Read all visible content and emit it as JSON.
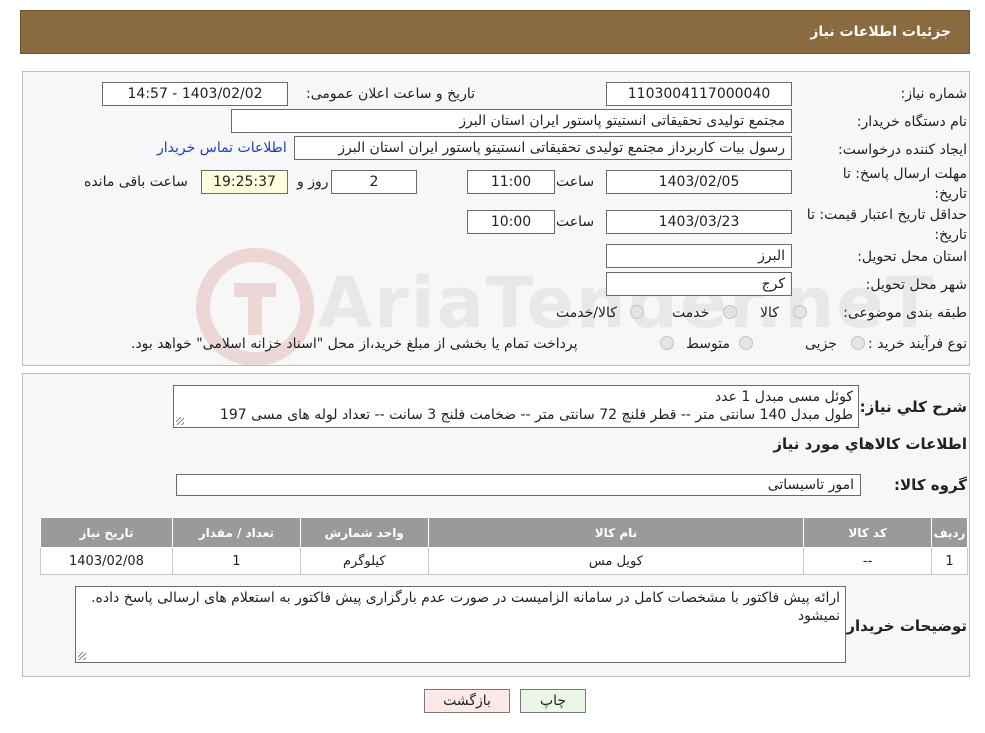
{
  "header": {
    "title": "جزئیات اطلاعات نیاز"
  },
  "form": {
    "need_number_label": "شماره نیاز:",
    "need_number": "1103004117000040",
    "announce_label": "تاریخ و ساعت اعلان عمومی:",
    "announce_value": "1403/02/02 - 14:57",
    "buyer_org_label": "نام دستگاه خریدار:",
    "buyer_org": "مجتمع تولیدی تحقیقاتی انستیتو پاستور ایران استان البرز",
    "requester_label": "ایجاد کننده درخواست:",
    "requester": "رسول بیات کاربرداز مجتمع تولیدی تحقیقاتی انستیتو پاستور ایران استان البرز",
    "contact_link": "اطلاعات تماس خریدار",
    "deadline_label_1": "مهلت ارسال پاسخ: تا",
    "deadline_label_2": "تاریخ:",
    "deadline_date": "1403/02/05",
    "time_label": "ساعت",
    "deadline_time": "11:00",
    "days_value": "2",
    "days_label": "روز و",
    "remaining_time": "19:25:37",
    "remaining_label": "ساعت باقی مانده",
    "validity_label_1": "حداقل تاریخ اعتبار قیمت: تا",
    "validity_label_2": "تاریخ:",
    "validity_date": "1403/03/23",
    "validity_time": "10:00",
    "province_label": "استان محل تحویل:",
    "province": "البرز",
    "city_label": "شهر محل تحویل:",
    "city": "کرج",
    "category_label": "طبقه بندی موضوعی:",
    "category_opt1": "کالا",
    "category_opt2": "خدمت",
    "category_opt3": "کالا/خدمت",
    "process_label": "نوع فرآیند خرید :",
    "process_opt1": "جزیی",
    "process_opt2": "متوسط",
    "process_note": "پرداخت تمام یا بخشی از مبلغ خرید،از محل \"اسناد خزانه اسلامی\" خواهد بود."
  },
  "description": {
    "label": "شرح کلي نياز:",
    "line1": "کوئل مسی مبدل    1 عدد",
    "line2": "طول مبدل 140 سانتی متر -- قطر فلنچ 72 سانتی متر -- ضخامت فلنج 3 سانت -- تعداد لوله های مسی 197"
  },
  "goods_section": {
    "title": "اطلاعات کالاهاي مورد نياز",
    "group_label": "گروه کالا:",
    "group_value": "امور تاسیساتی"
  },
  "table": {
    "headers": [
      "ردیف",
      "کد کالا",
      "نام کالا",
      "واحد شمارش",
      "تعداد / مقدار",
      "تاریخ نیاز"
    ],
    "rows": [
      [
        "1",
        "--",
        "کویل مس",
        "کیلوگرم",
        "1",
        "1403/02/08"
      ]
    ]
  },
  "buyer_notes": {
    "label": "توضیحات خریدار:",
    "text": "ارائه پیش فاکتور با مشخصات کامل در سامانه الزامیست در صورت عدم بارگزاری پیش فاکتور به استعلام های ارسالی پاسخ داده. نمیشود"
  },
  "buttons": {
    "print": "چاپ",
    "back": "بازگشت"
  },
  "watermark": {
    "text": "AriaTender.neT"
  },
  "colors": {
    "header_bg": "#8a6b3f",
    "link": "#1a3ec9",
    "back_bg": "#fde7e7",
    "print_bg": "#eaf7e5"
  }
}
